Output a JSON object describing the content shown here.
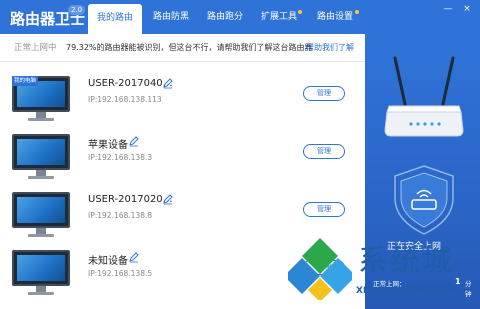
{
  "app": {
    "title": "路由器卫士",
    "version": "2.0"
  },
  "tabs": [
    {
      "label": "我的路由",
      "active": true
    },
    {
      "label": "路由防黑",
      "active": false
    },
    {
      "label": "路由跑分",
      "active": false
    },
    {
      "label": "扩展工具",
      "active": false
    },
    {
      "label": "路由设置",
      "active": false
    }
  ],
  "window_controls": {
    "minimize": "—",
    "close": "×"
  },
  "notice": {
    "status": "正常上网中",
    "message": "79.32%的路由器能被识别，但这台不行，请帮助我们了解这台路由器",
    "link": "帮助我们了解"
  },
  "devices": [
    {
      "name": "USER-2017040…",
      "ip": "IP:192.168.138.113",
      "badge": "我的电脑",
      "manage_label": "管理"
    },
    {
      "name": "苹果设备",
      "ip": "IP:192.168.138.3",
      "badge": "",
      "manage_label": "管理"
    },
    {
      "name": "USER-2017020…",
      "ip": "IP:192.168.138.8",
      "badge": "",
      "manage_label": "管理"
    },
    {
      "name": "未知设备",
      "ip": "IP:192.168.138.5",
      "badge": "",
      "manage_label": "管理"
    }
  ],
  "right_panel": {
    "status": "正在安全上网",
    "online_label": "正常上网：",
    "online_count": "1",
    "online_unit": "分钟"
  },
  "watermark": {
    "text": "系统城",
    "url": "XITONGCHENG.COM"
  },
  "colors": {
    "accent": "#2f73d8",
    "link": "#2f73d8",
    "panel": "#2b67c9"
  }
}
